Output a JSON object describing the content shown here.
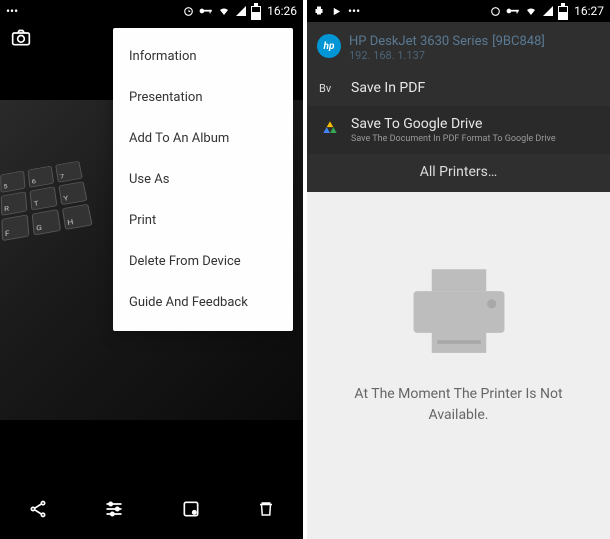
{
  "left": {
    "statusbar": {
      "time": "16:26"
    },
    "menu": {
      "items": [
        "Information",
        "Presentation",
        "Add To An Album",
        "Use As",
        "Print",
        "Delete From Device",
        "Guide And Feedback"
      ]
    }
  },
  "right": {
    "statusbar": {
      "time": "16:27"
    },
    "printer": {
      "name": "HP DeskJet 3630 Series",
      "code": "[9BC848]",
      "ip": "192. 168. 1.137"
    },
    "options": {
      "save_pdf_label": "Save In PDF",
      "pdf_prefix": "Bv",
      "drive_label": "Save To Google Drive",
      "drive_sub": "Save The Document In PDF Format To Google Drive",
      "all_printers": "All Printers…"
    },
    "empty": {
      "message": "At The Moment The Printer Is Not Available."
    }
  }
}
